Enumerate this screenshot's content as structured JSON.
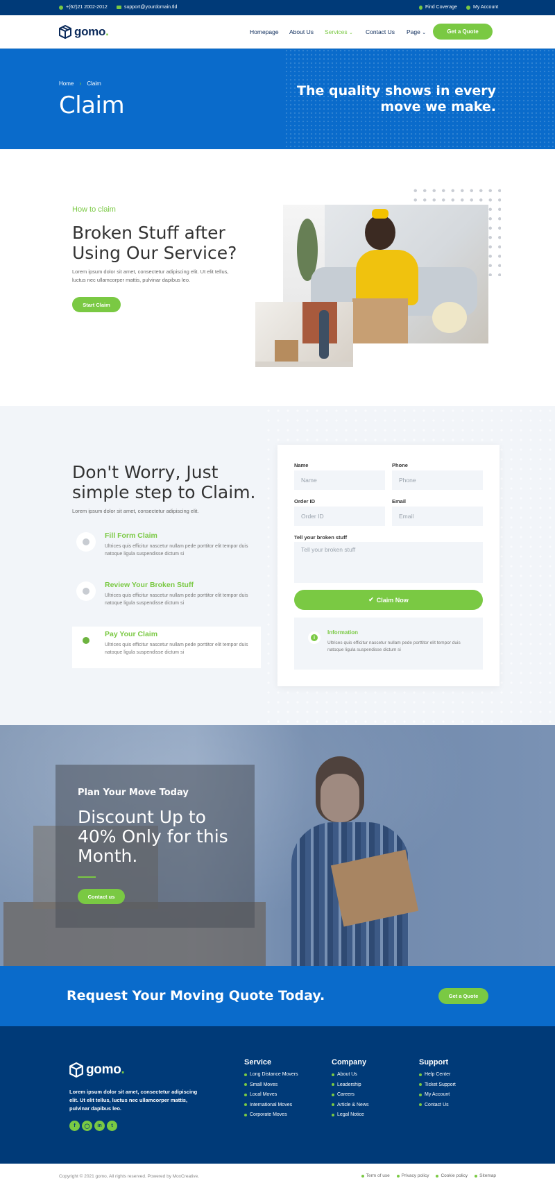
{
  "topbar": {
    "phone": "+(62)21 2002-2012",
    "email": "support@yourdomain.tld",
    "find_coverage": "Find Coverage",
    "my_account": "My Account"
  },
  "brand": {
    "name": "gomo",
    "dot": "."
  },
  "nav": {
    "items": [
      "Homepage",
      "About Us",
      "Services",
      "Contact Us",
      "Page"
    ],
    "active": "Services",
    "cta": "Get a Quote"
  },
  "hero": {
    "breadcrumb": [
      "Home",
      "Claim"
    ],
    "title": "Claim",
    "tagline": "The quality shows in every move we make."
  },
  "how": {
    "eyebrow": "How to claim",
    "heading": "Broken Stuff after Using Our Service?",
    "text": "Lorem ipsum dolor sit amet, consectetur adipiscing elit. Ut elit tellus, luctus nec ullamcorper mattis, pulvinar dapibus leo.",
    "button": "Start Claim"
  },
  "claim": {
    "heading": "Don't Worry, Just simple step to Claim.",
    "text": "Lorem ipsum dolor sit amet, consectetur adipiscing elit.",
    "steps": [
      {
        "title": "Fill Form Claim",
        "text": "Ultrices quis efficitur nascetur nullam pede porttitor elit tempor duis natoque ligula suspendisse dictum si"
      },
      {
        "title": "Review Your Broken Stuff",
        "text": "Ultrices quis efficitur nascetur nullam pede porttitor elit tempor duis natoque ligula suspendisse dictum si"
      },
      {
        "title": "Pay Your Claim",
        "text": "Ultrices quis efficitur nascetur nullam pede porttitor elit tempor duis natoque ligula suspendisse dictum si"
      }
    ],
    "form": {
      "name_label": "Name",
      "name_placeholder": "Name",
      "phone_label": "Phone",
      "phone_placeholder": "Phone",
      "order_label": "Order ID",
      "order_placeholder": "Order ID",
      "email_label": "Email",
      "email_placeholder": "Email",
      "message_label": "Tell your broken stuff",
      "message_placeholder": "Tell your broken stuff",
      "submit": "Claim Now",
      "info_title": "Information",
      "info_text": "Ultrices quis efficitur nascetur nullam pede porttitor elit tempor duis natoque ligula suspendisse dictum si"
    }
  },
  "discount": {
    "eyebrow": "Plan Your Move Today",
    "heading": "Discount Up to 40% Only for this Month.",
    "button": "Contact us"
  },
  "band": {
    "text": "Request Your Moving Quote Today.",
    "button": "Get a Quote"
  },
  "footer": {
    "about": "Lorem ipsum dolor sit amet, consectetur adipiscing elit. Ut elit tellus, luctus nec ullamcorper mattis, pulvinar dapibus leo.",
    "social": [
      "facebook-icon",
      "instagram-icon",
      "linkedin-icon",
      "twitter-icon"
    ],
    "columns": [
      {
        "title": "Service",
        "links": [
          "Long Distance Movers",
          "Small Moves",
          "Local Moves",
          "International Moves",
          "Corporate Moves"
        ]
      },
      {
        "title": "Company",
        "links": [
          "About Us",
          "Leadership",
          "Careers",
          "Article & News",
          "Legal Notice"
        ]
      },
      {
        "title": "Support",
        "links": [
          "Help Center",
          "Ticket Support",
          "My Account",
          "Contact Us"
        ]
      }
    ]
  },
  "bottom": {
    "copyright": "Copyright © 2021 gomo, All rights reserved. Powered by MoxCreative.",
    "links": [
      "Term of use",
      "Privacy policy",
      "Cookie policy",
      "Sitemap"
    ]
  },
  "colors": {
    "navy": "#003a78",
    "blue": "#0a6bcb",
    "green": "#7ac943"
  }
}
